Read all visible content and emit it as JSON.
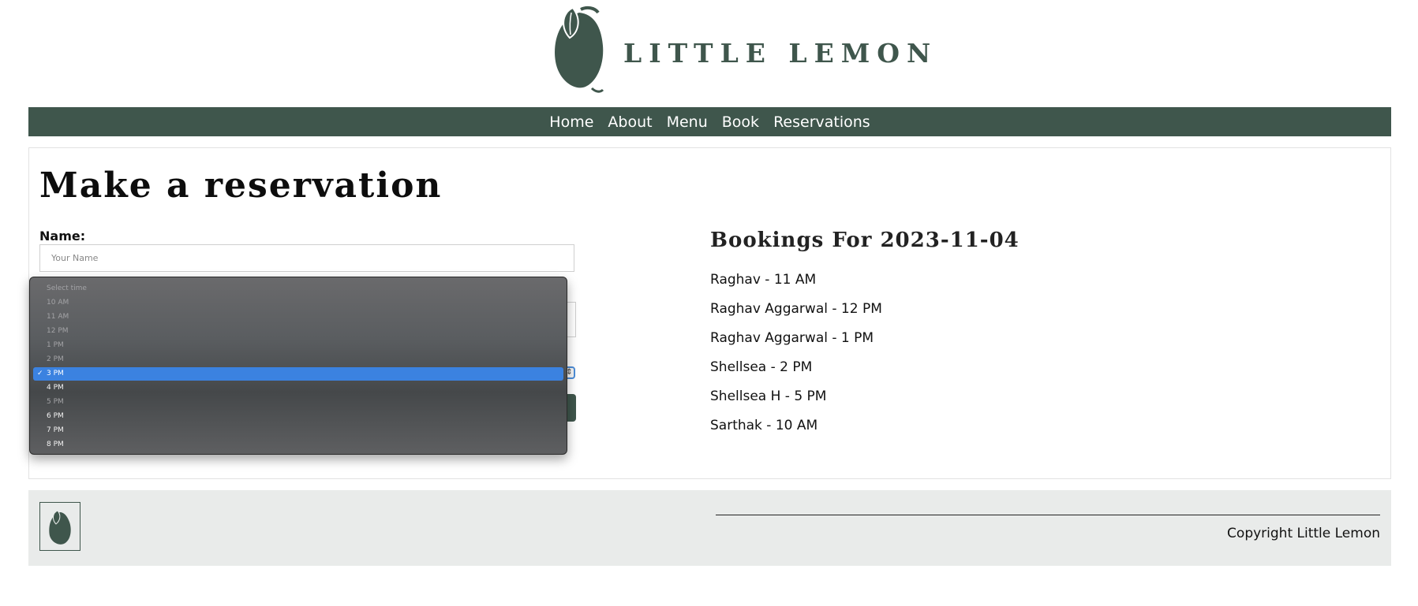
{
  "brand": {
    "name": "LITTLE LEMON"
  },
  "nav": [
    {
      "label": "Home"
    },
    {
      "label": "About"
    },
    {
      "label": "Menu"
    },
    {
      "label": "Book"
    },
    {
      "label": "Reservations"
    }
  ],
  "page": {
    "title": "Make a reservation"
  },
  "form": {
    "name_label": "Name:",
    "name_placeholder": "Your Name",
    "name_value": "",
    "time_select": {
      "selected": "3 PM",
      "options": [
        {
          "label": "Select time",
          "disabled": true
        },
        {
          "label": "10 AM",
          "disabled": true
        },
        {
          "label": "11 AM",
          "disabled": true
        },
        {
          "label": "12 PM",
          "disabled": true
        },
        {
          "label": "1 PM",
          "disabled": true
        },
        {
          "label": "2 PM",
          "disabled": true
        },
        {
          "label": "3 PM",
          "disabled": false,
          "selected": true
        },
        {
          "label": "4 PM",
          "disabled": false
        },
        {
          "label": "5 PM",
          "disabled": true
        },
        {
          "label": "6 PM",
          "disabled": false
        },
        {
          "label": "7 PM",
          "disabled": false
        },
        {
          "label": "8 PM",
          "disabled": false
        }
      ]
    }
  },
  "bookings": {
    "title": "Bookings For 2023-11-04",
    "items": [
      {
        "text": "Raghav - 11 AM"
      },
      {
        "text": "Raghav Aggarwal - 12 PM"
      },
      {
        "text": "Raghav Aggarwal - 1 PM"
      },
      {
        "text": "Shellsea - 2 PM"
      },
      {
        "text": "Shellsea H - 5 PM"
      },
      {
        "text": "Sarthak - 10 AM"
      }
    ]
  },
  "footer": {
    "copyright": "Copyright Little Lemon"
  },
  "colors": {
    "brand_green": "#3f564c",
    "selection_blue": "#3b82e0",
    "footer_bg": "#e9ebea"
  }
}
